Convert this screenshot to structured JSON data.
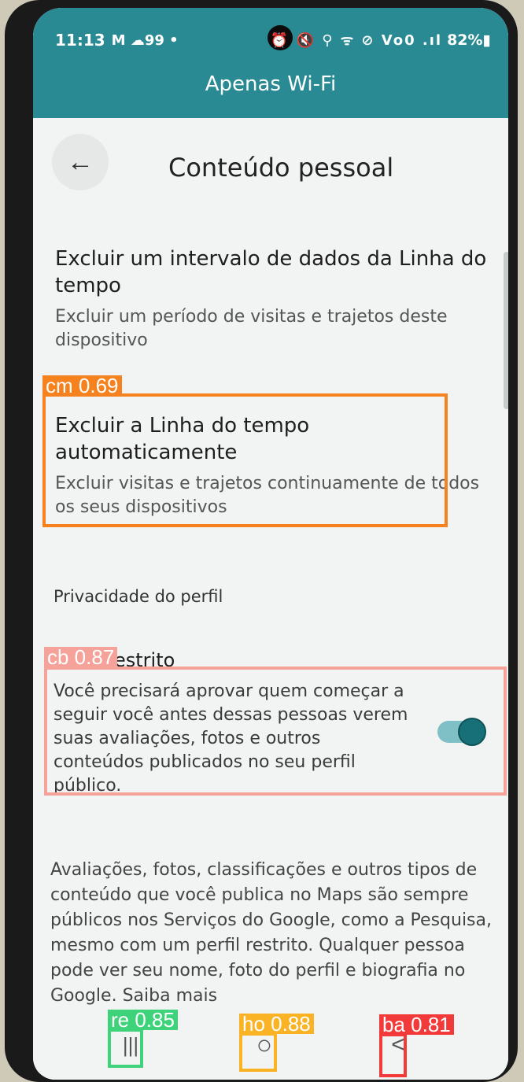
{
  "status": {
    "time": "11:13",
    "left_icons": "M ☁99 •",
    "right_icons": "⏰ 🔇 ⚲ ᯤ ⊘ Vo0 .ıl",
    "battery": "82%▮"
  },
  "connection_banner": "Apenas Wi-Fi",
  "appbar": {
    "title": "Conteúdo pessoal",
    "back_icon": "arrow-left-icon"
  },
  "items": [
    {
      "title": "Excluir um intervalo de dados da Linha do tempo",
      "subtitle": "Excluir um período de visitas e trajetos deste dispositivo"
    },
    {
      "title": "Excluir a Linha do tempo automaticamente",
      "subtitle": "Excluir visitas e trajetos continuamente de todos os seus dispositivos"
    }
  ],
  "profile_section": {
    "header": "Privacidade do perfil",
    "restricted_title": "Perfil restrito",
    "restricted_desc": "Você precisará aprovar quem começar a seguir você antes dessas pessoas verem suas avaliações, fotos e outros conteúdos publicados no seu perfil público.",
    "toggle_on": true
  },
  "footer": "Avaliações, fotos, classificações e outros tipos de conteúdo que você publica no Maps são sempre públicos nos Serviços do Google, como a Pesquisa, mesmo com um perfil restrito. Qualquer pessoa pode ver seu nome, foto do perfil e biografia no Google. Saiba mais",
  "nav": {
    "recents": "|||",
    "home": "○",
    "back": "<"
  },
  "detections": [
    {
      "label": "cm 0.69",
      "color": "#f5821f"
    },
    {
      "label": "cb 0.87",
      "color": "#f5a29a"
    },
    {
      "label": "re 0.85",
      "color": "#3ed37a"
    },
    {
      "label": "ho 0.88",
      "color": "#f9b325"
    },
    {
      "label": "ba 0.81",
      "color": "#f23a3a"
    }
  ]
}
